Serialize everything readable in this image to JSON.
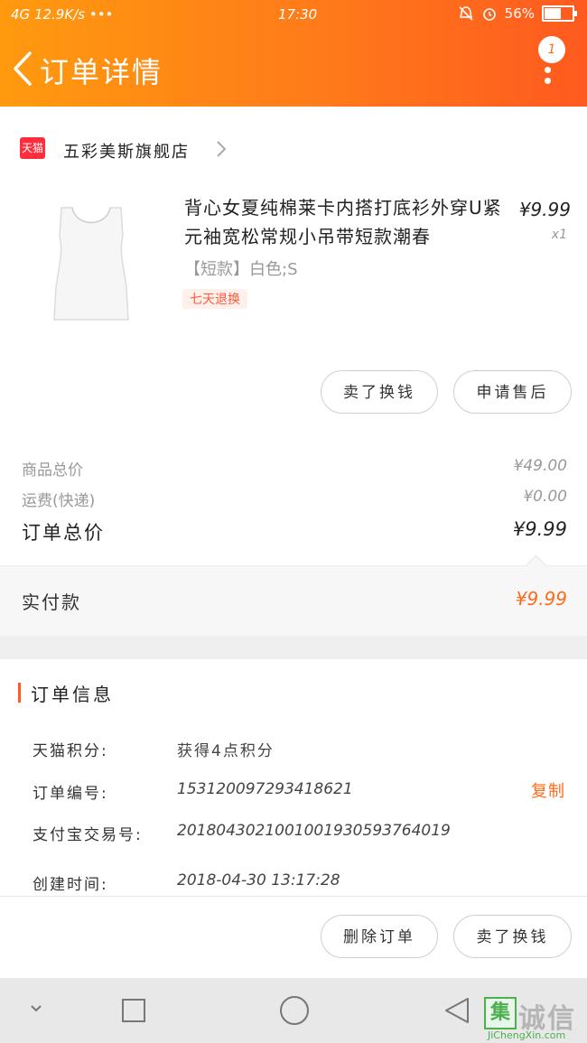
{
  "status_bar": {
    "signal": "4G",
    "speed": "12.9K/s",
    "extra": "•••",
    "time": "17:30",
    "battery": "56%"
  },
  "header": {
    "title": "订单详情",
    "message_count": "1"
  },
  "store": {
    "platform_badge": "天猫",
    "name": "五彩美斯旗舰店"
  },
  "product": {
    "title": "背心女夏纯棉莱卡内搭打底衫外穿U紧元袖宽松常规小吊带短款潮春",
    "sku": "【短款】白色;S",
    "badge": "七天退换",
    "price": "¥9.99",
    "quantity": "x1"
  },
  "product_actions": {
    "sell_label": "卖了换钱",
    "after_sale_label": "申请售后"
  },
  "fees": {
    "goods_label": "商品总价",
    "goods_value": "¥49.00",
    "shipping_label": "运费(快递)",
    "shipping_value": "¥0.00",
    "total_label": "订单总价",
    "total_value": "¥9.99",
    "paid_label": "实付款",
    "paid_value": "¥9.99"
  },
  "order_info": {
    "section_title": "订单信息",
    "points_label": "天猫积分:",
    "points_value": "获得4点积分",
    "order_no_label": "订单编号:",
    "order_no_value": "153120097293418621",
    "copy_label": "复制",
    "alipay_label": "支付宝交易号:",
    "alipay_value": "2018043021001001930593764019",
    "created_label": "创建时间:",
    "created_value": "2018-04-30 13:17:28"
  },
  "footer_actions": {
    "delete_label": "删除订单",
    "sell_label": "卖了换钱"
  },
  "watermark": {
    "mark": "集",
    "text": "诚信",
    "url": "JiChengXin.com"
  },
  "colors": {
    "accent": "#ff6a1a",
    "header_start": "#ff9a0f",
    "header_end": "#ff5a1f"
  }
}
